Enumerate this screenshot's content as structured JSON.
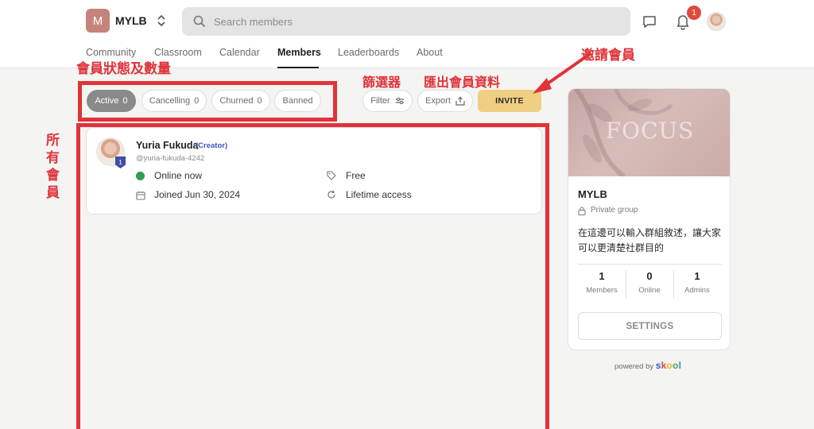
{
  "header": {
    "logo_letter": "M",
    "group_name": "MYLB",
    "search_placeholder": "Search members",
    "notification_count": "1",
    "icons": {
      "switch": "chevron-up-down-icon",
      "search": "search-icon",
      "chat": "chat-icon",
      "bell": "bell-icon"
    }
  },
  "nav": {
    "tabs": [
      {
        "label": "Community"
      },
      {
        "label": "Classroom"
      },
      {
        "label": "Calendar"
      },
      {
        "label": "Members",
        "active": true
      },
      {
        "label": "Leaderboards"
      },
      {
        "label": "About"
      }
    ]
  },
  "filters": {
    "pills": [
      {
        "label": "Active",
        "count": "0",
        "active": true
      },
      {
        "label": "Cancelling",
        "count": "0"
      },
      {
        "label": "Churned",
        "count": "0"
      },
      {
        "label": "Banned",
        "count": ""
      }
    ],
    "filter_label": "Filter",
    "export_label": "Export",
    "invite_label": "INVITE"
  },
  "member": {
    "name": "Yuria Fukuda",
    "role": "(Creator)",
    "handle": "@yuria-fukuda-4242",
    "level": "1",
    "status": "Online now",
    "joined": "Joined Jun 30, 2024",
    "plan": "Free",
    "access": "Lifetime access"
  },
  "sidebar": {
    "cover_text": "FOCUS",
    "title": "MYLB",
    "privacy": "Private group",
    "description": "在這邊可以輸入群組敘述，讓大家可以更清楚社群目的",
    "stats": [
      {
        "value": "1",
        "label": "Members"
      },
      {
        "value": "0",
        "label": "Online"
      },
      {
        "value": "1",
        "label": "Admins"
      }
    ],
    "settings_label": "SETTINGS"
  },
  "footer": {
    "powered_by": "powered by",
    "brand": "skool",
    "brand_colors": [
      "#2e5fd6",
      "#e0483d",
      "#f2b52a",
      "#4aa35a",
      "#2e8fd6"
    ]
  },
  "annotations": {
    "member_status": "會員狀態及數量",
    "filter": "篩選器",
    "export": "匯出會員資料",
    "invite": "邀請會員",
    "all_members": "所有會員",
    "color": "#e0333a"
  }
}
